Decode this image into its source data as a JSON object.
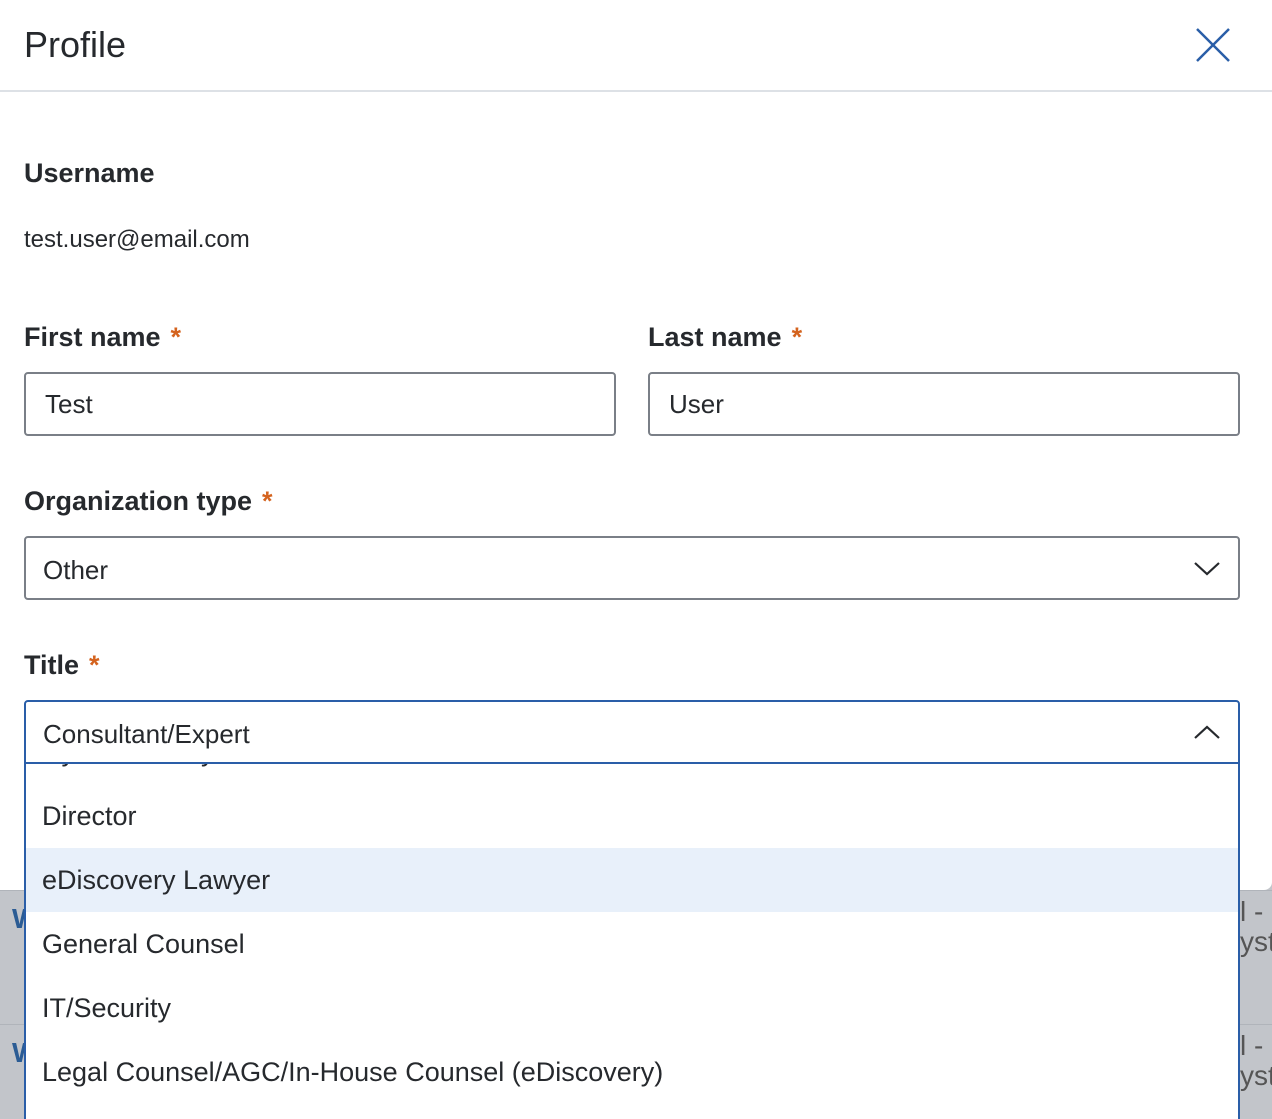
{
  "modal": {
    "title": "Profile",
    "close_icon": "close-icon"
  },
  "form": {
    "username_label": "Username",
    "username_value": "test.user@email.com",
    "first_name_label": "First name",
    "first_name_value": "Test",
    "last_name_label": "Last name",
    "last_name_value": "User",
    "required_marker": "*",
    "org_type_label": "Organization type",
    "org_type_value": "Other",
    "title_label": "Title",
    "title_value": "Consultant/Expert",
    "title_options": [
      "Cyber security/Forensics",
      "Director",
      "eDiscovery Lawyer",
      "General Counsel",
      "IT/Security",
      "Legal Counsel/AGC/In-House Counsel (eDiscovery)"
    ],
    "highlighted_option": "eDiscovery Lawyer"
  },
  "background": {
    "row1_left": "W",
    "row1_right": "l -\nyst",
    "row2_left": "W",
    "row2_right": "l -\nyst"
  },
  "colors": {
    "accent": "#2a5ea8",
    "required": "#d4631e",
    "highlight": "#e8f0fa",
    "text": "#26292d"
  }
}
